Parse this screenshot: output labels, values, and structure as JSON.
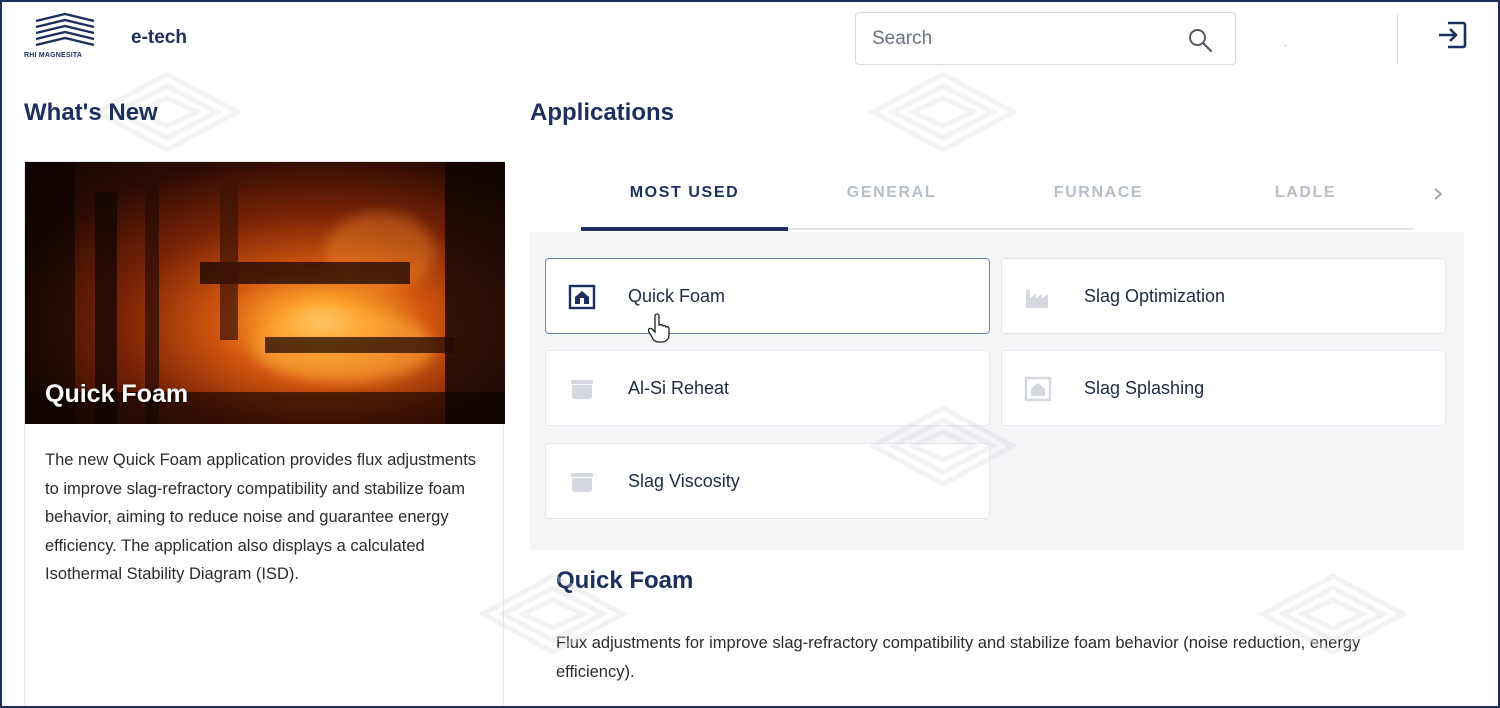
{
  "header": {
    "logo_text": "RHI MAGNESITA",
    "app_name": "e-tech",
    "search_placeholder": "Search",
    "status_dot": "."
  },
  "whats_new": {
    "heading": "What's New",
    "card_title": "Quick Foam",
    "card_body": "The new Quick Foam application provides flux adjustments to improve slag-refractory compatibility and stabilize foam behavior, aiming to reduce noise and guarantee energy efficiency. The application also displays a calculated Isothermal Stability Diagram (ISD)."
  },
  "applications": {
    "heading": "Applications",
    "tabs": [
      {
        "label": "MOST USED",
        "active": true
      },
      {
        "label": "GENERAL",
        "active": false
      },
      {
        "label": "FURNACE",
        "active": false
      },
      {
        "label": "LADLE",
        "active": false
      }
    ],
    "items": [
      {
        "label": "Quick Foam",
        "icon": "furnace-app-icon",
        "selected": true
      },
      {
        "label": "Slag Optimization",
        "icon": "factory-icon",
        "selected": false
      },
      {
        "label": "Al-Si Reheat",
        "icon": "ladle-icon",
        "selected": false
      },
      {
        "label": "Slag Splashing",
        "icon": "furnace-app-icon",
        "selected": false
      },
      {
        "label": "Slag Viscosity",
        "icon": "ladle-icon",
        "selected": false
      }
    ],
    "detail": {
      "title": "Quick Foam",
      "body": "Flux adjustments for improve slag-refractory compatibility and stabilize foam behavior (noise reduction, energy efficiency)."
    }
  },
  "colors": {
    "brand_navy": "#1c2f5e",
    "tab_inactive": "#b8bec8",
    "panel_bg": "#f4f5f7",
    "selected_border": "#6f85aa"
  }
}
